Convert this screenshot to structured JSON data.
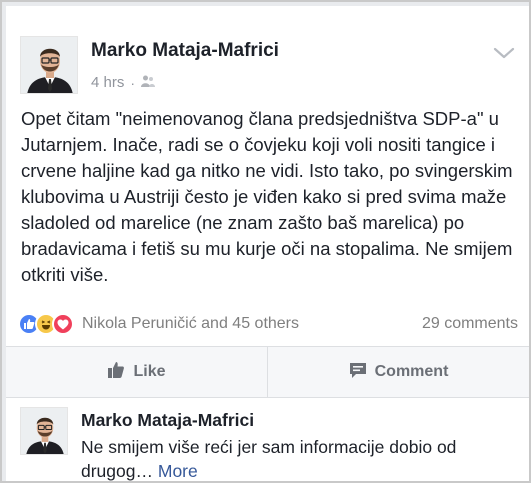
{
  "post": {
    "author": "Marko Mataja-Mafrici",
    "time": "4 hrs",
    "audience_icon": "friends-icon",
    "menu_icon": "chevron-down-icon",
    "text": "Opet čitam \"neimenovanog člana predsjedništva SDP-a\" u Jutarnjem. Inače, radi se o čovjeku koji voli nositi tangice i crvene haljine kad ga nitko ne vidi. Isto tako, po svingerskim klubovima u Austriji često je viđen kako si pred svima maže sladoled od marelice (ne znam zašto baš marelica) po bradavicama i fetiš su mu kurje oči na stopalima. Ne smijem otkriti više."
  },
  "reactions": {
    "icons": [
      "like-icon",
      "haha-icon",
      "love-icon"
    ],
    "names": "Nikola Peruničić and 45 others",
    "comments": "29 comments"
  },
  "actions": {
    "like_label": "Like",
    "comment_label": "Comment"
  },
  "comment": {
    "author": "Marko Mataja-Mafrici",
    "text": "Ne smijem više reći jer sam informacije dobio od drugog…",
    "more": "More"
  },
  "colors": {
    "link": "#365899",
    "muted": "#90949c",
    "like": "#4a80f5",
    "haha": "#f7c84a",
    "love": "#f0405b"
  }
}
